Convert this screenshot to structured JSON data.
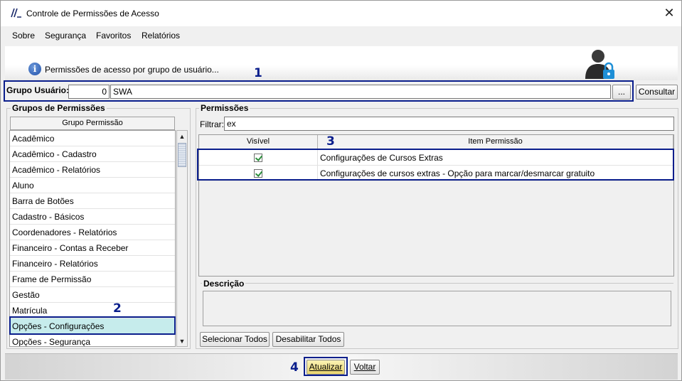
{
  "window": {
    "title": "Controle de Permissões de Acesso",
    "close_glyph": "✕"
  },
  "menu": [
    {
      "label": "Sobre"
    },
    {
      "label": "Segurança"
    },
    {
      "label": "Favoritos"
    },
    {
      "label": "Relatórios"
    }
  ],
  "header": {
    "text": "Permissões de acesso por grupo de usuário..."
  },
  "user_group": {
    "label": "Grupo Usuário:",
    "code": "0",
    "name": "SWA",
    "lookup_label": "...",
    "query_label": "Consultar"
  },
  "permission_groups": {
    "title": "Grupos de Permissões",
    "column_header": "Grupo Permissão",
    "items": [
      "Acadêmico",
      "Acadêmico - Cadastro",
      "Acadêmico - Relatórios",
      "Aluno",
      "Barra de Botões",
      "Cadastro - Básicos",
      "Coordenadores - Relatórios",
      "Financeiro - Contas a Receber",
      "Financeiro - Relatórios",
      "Frame de Permissão",
      "Gestão",
      "Matrícula",
      "Opções - Configurações",
      "Opções - Segurança"
    ],
    "selected": "Opções - Configurações"
  },
  "permissions": {
    "title": "Permissões",
    "filter_label": "Filtrar:",
    "filter_value": "ex",
    "columns": [
      "Visível",
      "Item Permissão"
    ],
    "rows": [
      {
        "visible": true,
        "item": "Configurações de Cursos Extras"
      },
      {
        "visible": true,
        "item": "Configurações de cursos extras - Opção para marcar/desmarcar gratuito"
      }
    ],
    "description_title": "Descrição",
    "select_all_label": "Selecionar Todos",
    "disable_all_label": "Desabilitar Todos"
  },
  "footer": {
    "update_label": "Atualizar",
    "back_label": "Voltar"
  },
  "callouts": [
    "1",
    "2",
    "3",
    "4"
  ],
  "colors": {
    "accent": "#0a1e8c",
    "selection": "#c6ecec",
    "primary_button": "#e9d56f"
  }
}
